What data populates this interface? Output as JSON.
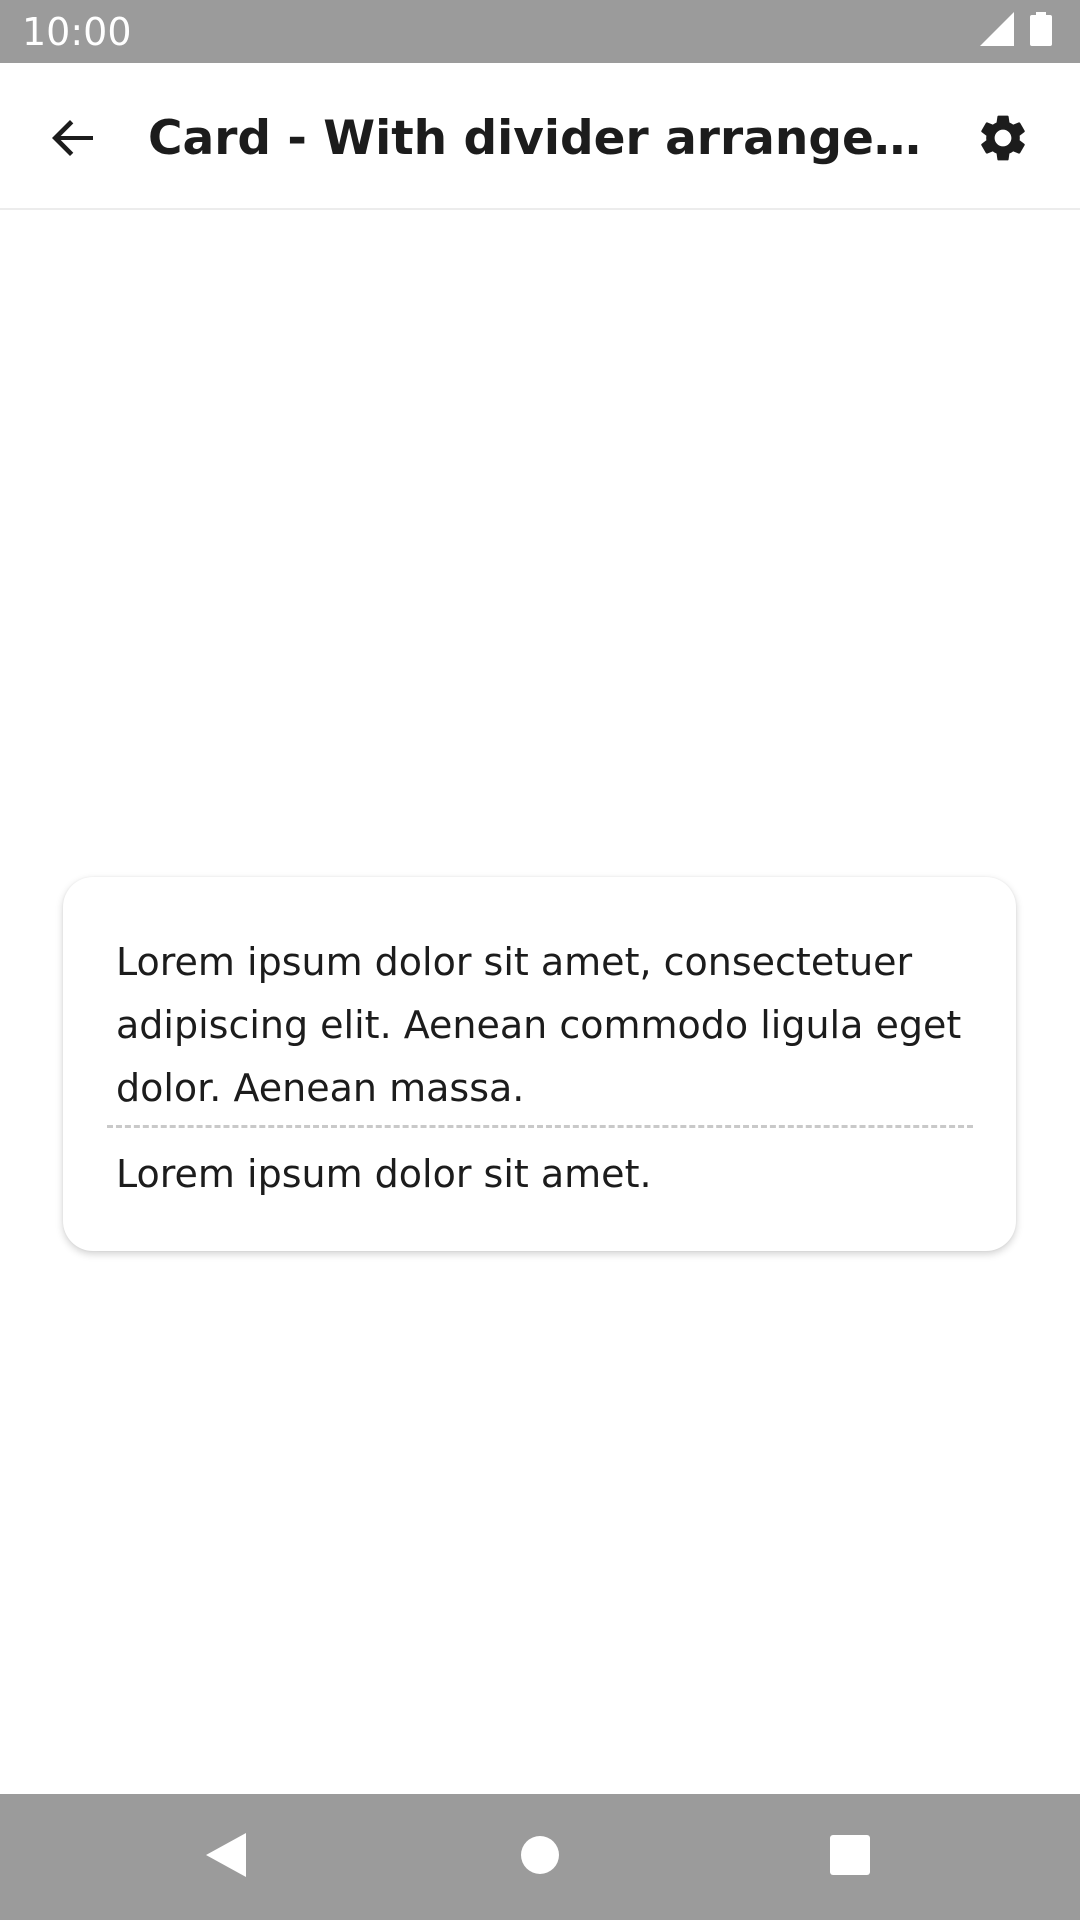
{
  "status_bar": {
    "time": "10:00",
    "icons": [
      "signal-icon",
      "battery-icon"
    ]
  },
  "app_bar": {
    "title": "Card - With divider arranged ve...",
    "back_icon": "arrow-back-icon",
    "settings_icon": "gear-icon"
  },
  "card": {
    "body": "Lorem ipsum dolor sit amet, consectetuer adipiscing elit. Aenean commodo ligula eget dolor. Aenean massa.",
    "footer": "Lorem ipsum dolor sit amet."
  },
  "nav_bar": {
    "icons": [
      "nav-back-icon",
      "nav-home-icon",
      "nav-recents-icon"
    ]
  },
  "colors": {
    "system_bar": "#9b9b9b",
    "text": "#1c1c1c",
    "divider": "#c9c9c9",
    "background": "#ffffff"
  }
}
